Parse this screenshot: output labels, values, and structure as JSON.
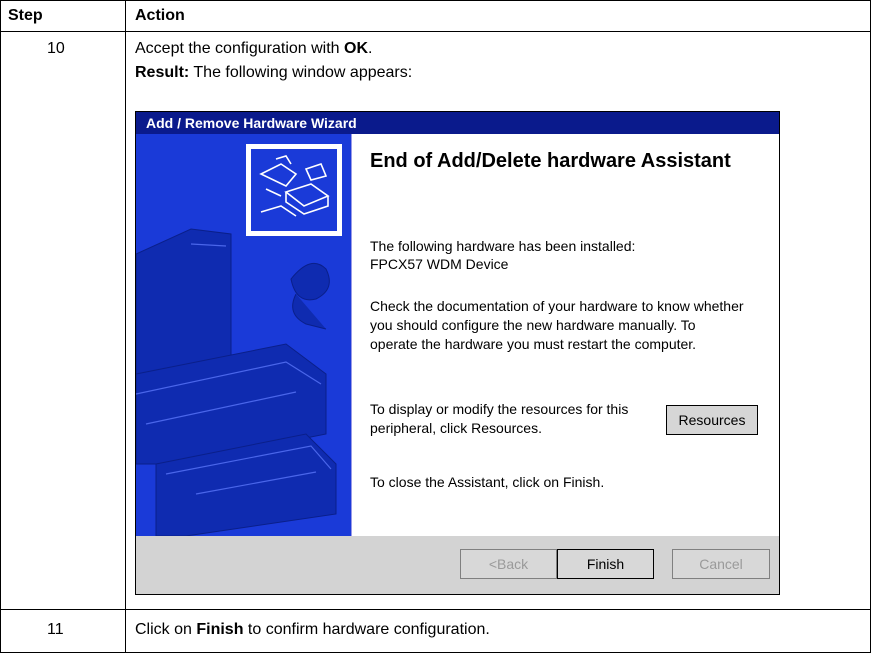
{
  "table": {
    "headers": {
      "step": "Step",
      "action": "Action"
    },
    "rows": [
      {
        "step": "10",
        "line1_prefix": "Accept the configuration with ",
        "line1_bold": "OK",
        "line1_suffix": ".",
        "line2_bold": "Result:",
        "line2_text": " The following window appears:"
      },
      {
        "step": "11",
        "prefix": "Click on ",
        "bold": "Finish",
        "suffix": " to confirm hardware configuration."
      }
    ]
  },
  "wizard": {
    "title_bar": "Add / Remove Hardware Wizard",
    "heading": "End of Add/Delete hardware Assistant",
    "installed_label": "The following hardware has been installed:",
    "device_name": "FPCX57 WDM Device",
    "doc_line1": "Check the documentation of your hardware to know whether",
    "doc_line2": "you should configure the new hardware manually.  To",
    "doc_line3": "operate the hardware you must restart the computer.",
    "res_line1": "To display or modify the resources for this",
    "res_line2": "peripheral, click Resources.",
    "close_text": "To close the Assistant, click on Finish.",
    "buttons": {
      "resources": "Resources",
      "back": "<Back",
      "finish": "Finish",
      "cancel": "Cancel"
    }
  }
}
